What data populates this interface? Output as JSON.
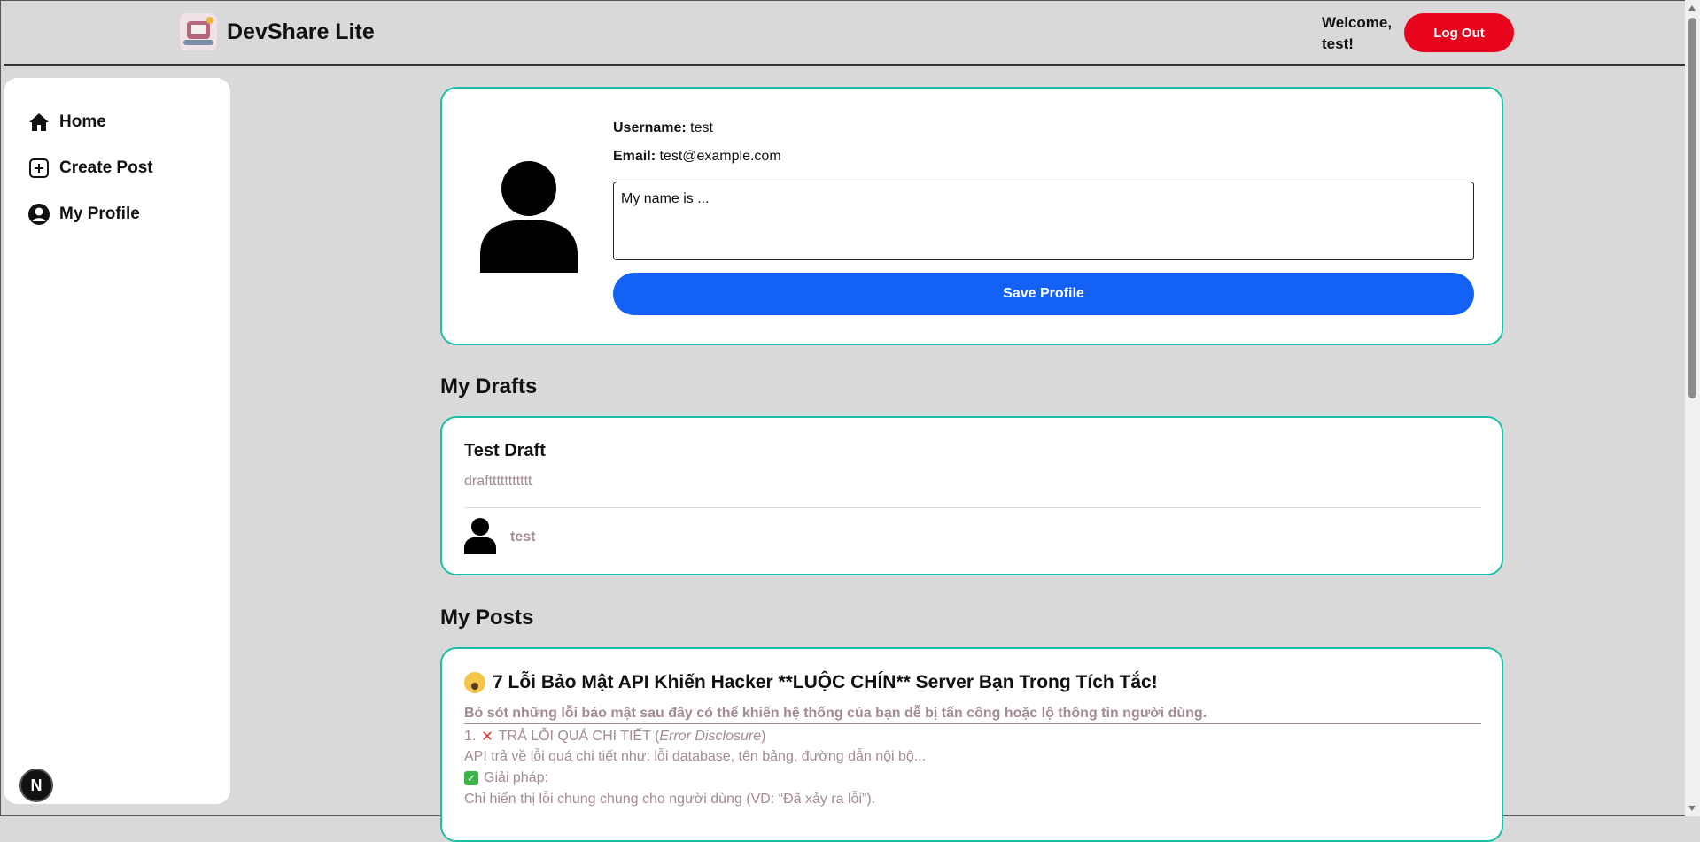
{
  "header": {
    "brand": "DevShare Lite",
    "welcome": "Welcome, test!",
    "logout_label": "Log Out"
  },
  "sidebar": {
    "items": [
      {
        "label": "Home",
        "icon": "home-icon"
      },
      {
        "label": "Create Post",
        "icon": "plus-square-icon"
      },
      {
        "label": "My Profile",
        "icon": "user-circle-icon"
      }
    ]
  },
  "profile": {
    "username_label": "Username:",
    "username": "test",
    "email_label": "Email:",
    "email": "test@example.com",
    "bio_value": "My name is ...",
    "save_label": "Save Profile"
  },
  "drafts": {
    "heading": "My Drafts",
    "items": [
      {
        "title": "Test Draft",
        "excerpt": "drafttttttttttt",
        "author": "test"
      }
    ]
  },
  "posts": {
    "heading": "My Posts",
    "items": [
      {
        "title": "7 Lỗi Bảo Mật API Khiến Hacker **LUỘC CHÍN** Server Bạn Trong Tích Tắc!",
        "subtitle": "Bỏ sót những lỗi bảo mật sau đây có thể khiến hệ thống của bạn dễ bị tấn công hoặc lộ thông tin người dùng.",
        "line1_prefix": "1.",
        "line1_text": "TRẢ LỖI QUÁ CHI TIẾT (",
        "line1_italic": "Error Disclosure",
        "line1_suffix": ")",
        "line2": "API trả về lỗi quá chi tiết như: lỗi database, tên bảng, đường dẫn nội bộ...",
        "line3": "Giải pháp:",
        "line4": "Chỉ hiển thị lỗi chung chung cho người dùng (VD: “Đã xảy ra lỗi”)."
      }
    ]
  },
  "colors": {
    "accent_border": "#1bbfa8",
    "logout_bg": "#e8041c",
    "save_bg": "#1462f5",
    "muted_text": "#a38a95"
  },
  "dev_badge": "N"
}
